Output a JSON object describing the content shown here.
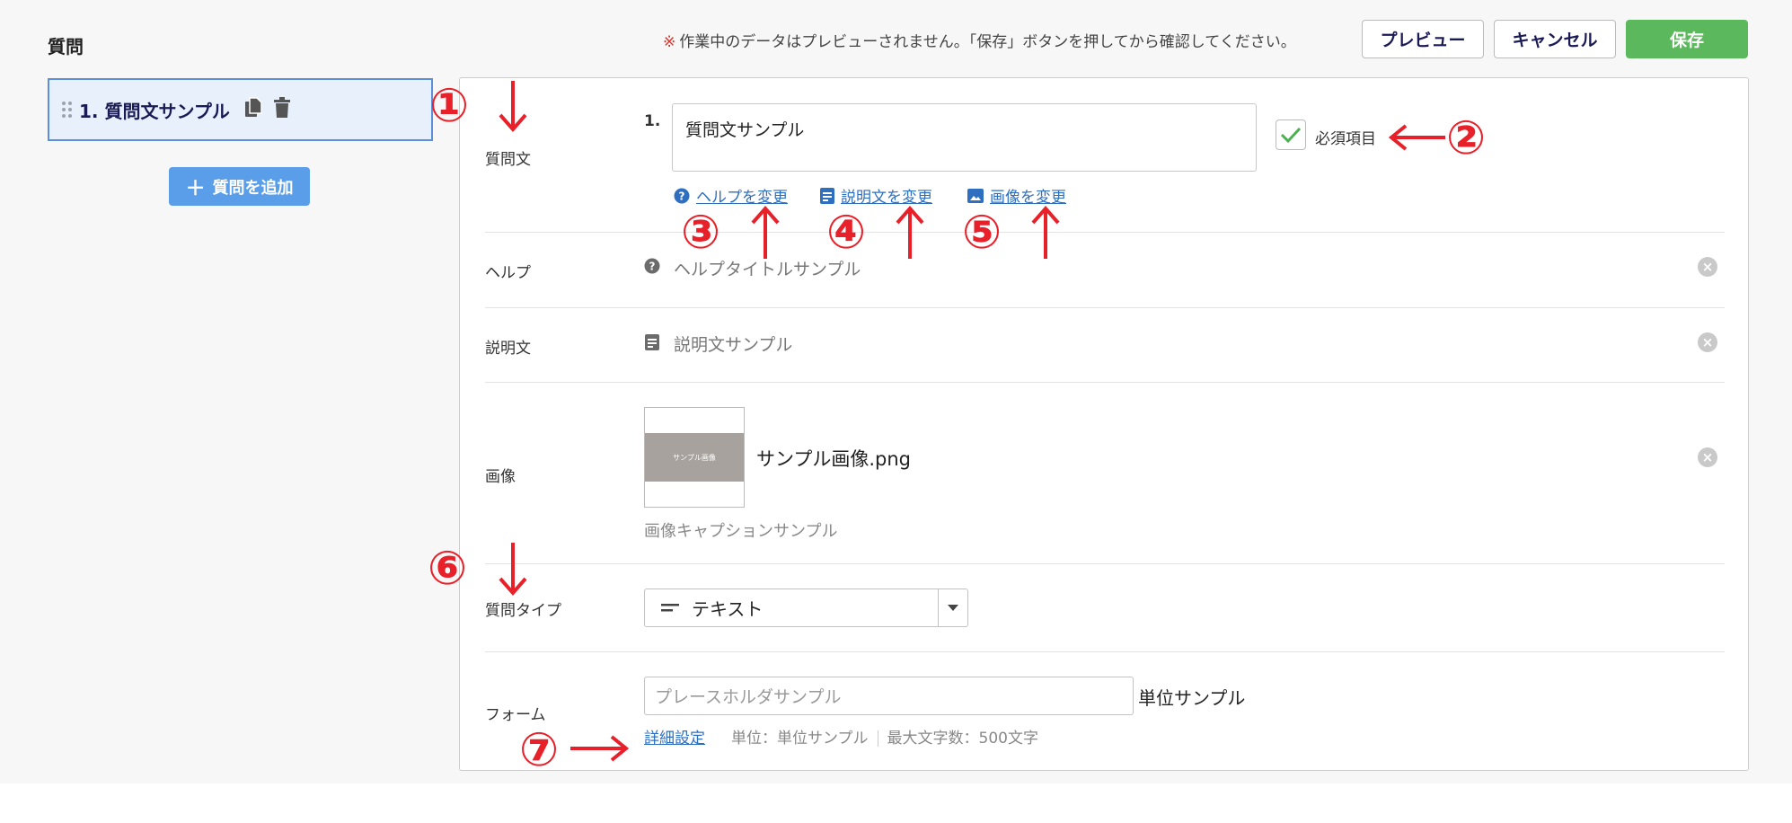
{
  "header": {
    "title": "質問",
    "notice_mark": "※",
    "notice": "作業中のデータはプレビューされません。「保存」ボタンを押してから確認してください。",
    "preview_label": "プレビュー",
    "cancel_label": "キャンセル",
    "save_label": "保存",
    "save_color": "#5cb85c"
  },
  "sidebar": {
    "items": [
      {
        "label": "1. 質問文サンプル",
        "active": true
      }
    ],
    "add_label": "質問を追加",
    "add_color": "#5a9de8"
  },
  "editor": {
    "question_label": "質問文",
    "question_number": "1.",
    "question_text": "質問文サンプル",
    "required_checked": true,
    "required_label": "必須項目",
    "links": {
      "help": "ヘルプを変更",
      "description": "説明文を変更",
      "image": "画像を変更"
    },
    "help_label": "ヘルプ",
    "help_value": "ヘルプタイトルサンプル",
    "description_label": "説明文",
    "description_value": "説明文サンプル",
    "image_label": "画像",
    "image_thumb_text": "サンプル画像",
    "image_filename": "サンプル画像.png",
    "image_caption": "画像キャプションサンプル",
    "type_label": "質問タイプ",
    "type_value": "テキスト",
    "form_label": "フォーム",
    "form_placeholder": "プレースホルダサンプル",
    "form_unit": "単位サンプル",
    "detail_link": "詳細設定",
    "meta_unit": "単位：単位サンプル",
    "meta_max": "最大文字数：500文字",
    "link_color": "#2f6fbf"
  },
  "annotations": {
    "color": "#e8202a",
    "markers": [
      "①",
      "②",
      "③",
      "④",
      "⑤",
      "⑥",
      "⑦"
    ]
  }
}
